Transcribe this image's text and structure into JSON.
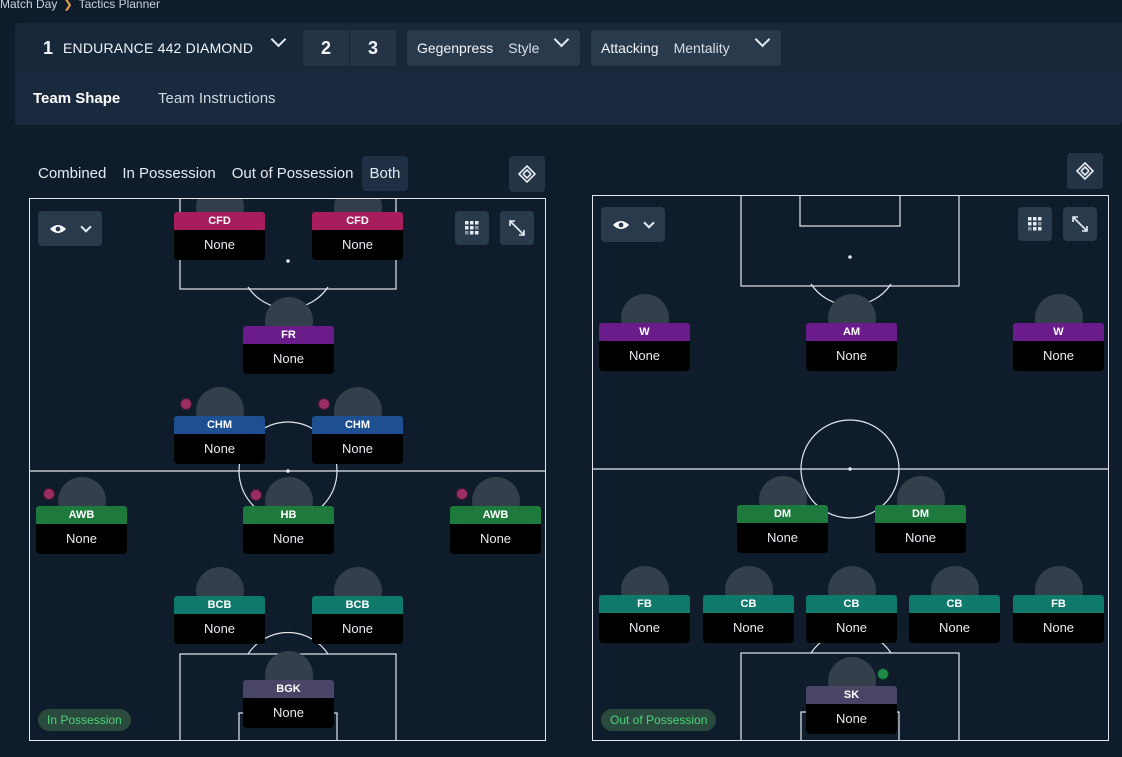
{
  "breadcrumb": {
    "parent": "Match Day",
    "current": "Tactics Planner"
  },
  "tactic": {
    "number": "1",
    "name": "ENDURANCE 442 DIAMOND",
    "slots": [
      "2",
      "3"
    ]
  },
  "style_dropdown": {
    "value": "Gegenpress",
    "label": "Style"
  },
  "mentality_dropdown": {
    "value": "Attacking",
    "label": "Mentality"
  },
  "subtabs": [
    "Team Shape",
    "Team Instructions"
  ],
  "view_tabs": [
    "Combined",
    "In Possession",
    "Out of Possession",
    "Both"
  ],
  "selected_view": "Both",
  "in_possession": {
    "phase_label": "In Possession",
    "players": [
      {
        "role": "CFD",
        "duty": "None"
      },
      {
        "role": "CFD",
        "duty": "None"
      },
      {
        "role": "FR",
        "duty": "None"
      },
      {
        "role": "CHM",
        "duty": "None"
      },
      {
        "role": "CHM",
        "duty": "None"
      },
      {
        "role": "AWB",
        "duty": "None"
      },
      {
        "role": "HB",
        "duty": "None"
      },
      {
        "role": "AWB",
        "duty": "None"
      },
      {
        "role": "BCB",
        "duty": "None"
      },
      {
        "role": "BCB",
        "duty": "None"
      },
      {
        "role": "BGK",
        "duty": "None"
      }
    ]
  },
  "out_of_possession": {
    "phase_label": "Out of Possession",
    "players": [
      {
        "role": "W",
        "duty": "None"
      },
      {
        "role": "AM",
        "duty": "None"
      },
      {
        "role": "W",
        "duty": "None"
      },
      {
        "role": "DM",
        "duty": "None"
      },
      {
        "role": "DM",
        "duty": "None"
      },
      {
        "role": "FB",
        "duty": "None"
      },
      {
        "role": "CB",
        "duty": "None"
      },
      {
        "role": "CB",
        "duty": "None"
      },
      {
        "role": "CB",
        "duty": "None"
      },
      {
        "role": "FB",
        "duty": "None"
      },
      {
        "role": "SK",
        "duty": "None"
      }
    ]
  },
  "colors": {
    "background": "#0f1c2c",
    "defender": "#0f7a6c",
    "wingback": "#1e7a3c",
    "midfield": "#1d4f91",
    "attacking_mid": "#6a1c8a",
    "striker": "#a81e5c",
    "keeper": "#494566",
    "phase_text": "#4cd37a",
    "breadcrumb_chevron": "#e8a64a"
  },
  "icons": [
    "chevron-right-icon",
    "chevron-down-icon",
    "eye-icon",
    "grid-icon",
    "expand-icon",
    "swap-icon",
    "role-badge-icon"
  ]
}
